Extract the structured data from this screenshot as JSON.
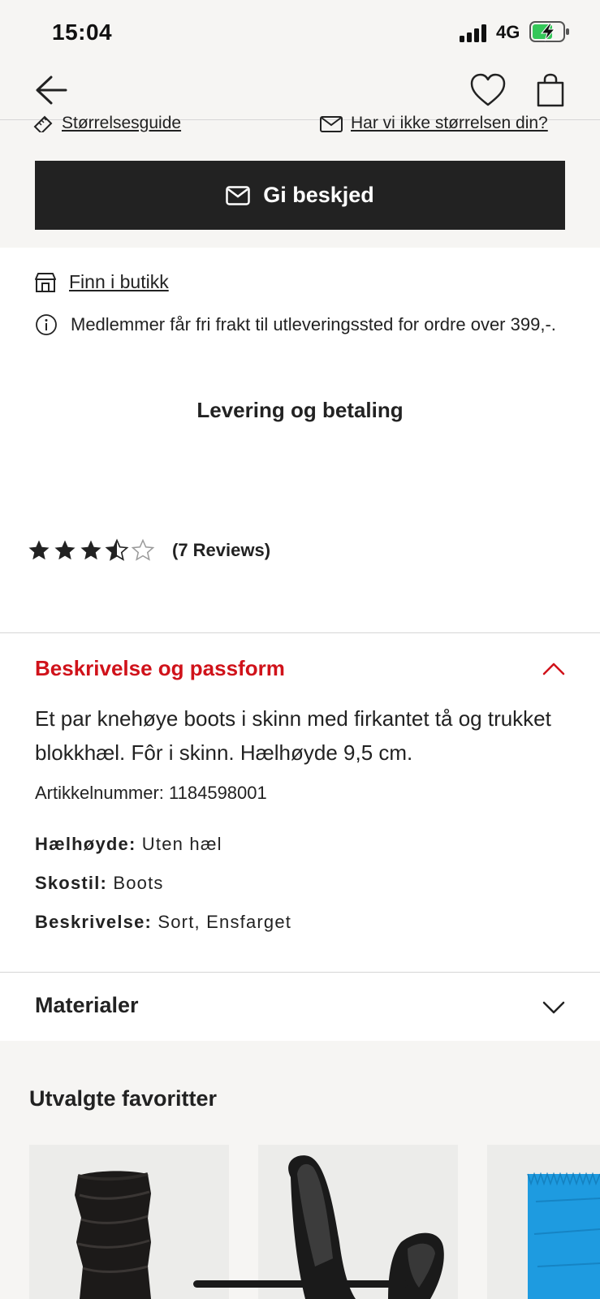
{
  "status_bar": {
    "time": "15:04",
    "network": "4G"
  },
  "nav": {
    "back_icon": "arrow-left-icon",
    "favorite_icon": "heart-icon",
    "bag_icon": "shopping-bag-icon"
  },
  "links": {
    "size_guide": "Størrelsesguide",
    "missing_size": "Har vi ikke størrelsen din?"
  },
  "notify_button": {
    "label": "Gi beskjed",
    "icon": "envelope-icon"
  },
  "store": {
    "find_in_store": "Finn i butikk",
    "icon": "store-icon"
  },
  "info": {
    "text": "Medlemmer får fri frakt til utleveringssted for ordre over 399,-.",
    "icon": "info-icon"
  },
  "delivery": {
    "heading": "Levering og betaling"
  },
  "rating": {
    "value": 3.5,
    "max": 5,
    "reviews_label": "(7 Reviews)"
  },
  "description": {
    "header": "Beskrivelse og passform",
    "text": "Et par knehøye boots i skinn med firkantet tå og trukket blokkhæl. Fôr i skinn.  Hælhøyde 9,5 cm.",
    "article_number": "Artikkelnummer: 1184598001",
    "specs": [
      {
        "key": "Hælhøyde:",
        "value": "Uten hæl"
      },
      {
        "key": "Skostil:",
        "value": "Boots"
      },
      {
        "key": "Beskrivelse:",
        "value": "Sort, Ensfarget"
      }
    ]
  },
  "materials": {
    "header": "Materialer"
  },
  "favorites": {
    "title": "Utvalgte favoritter"
  },
  "colors": {
    "accent_red": "#d0121a",
    "button_dark": "#222222",
    "section_bg": "#f6f5f3",
    "battery_green": "#34c759",
    "product_blue": "#1e9be0"
  }
}
